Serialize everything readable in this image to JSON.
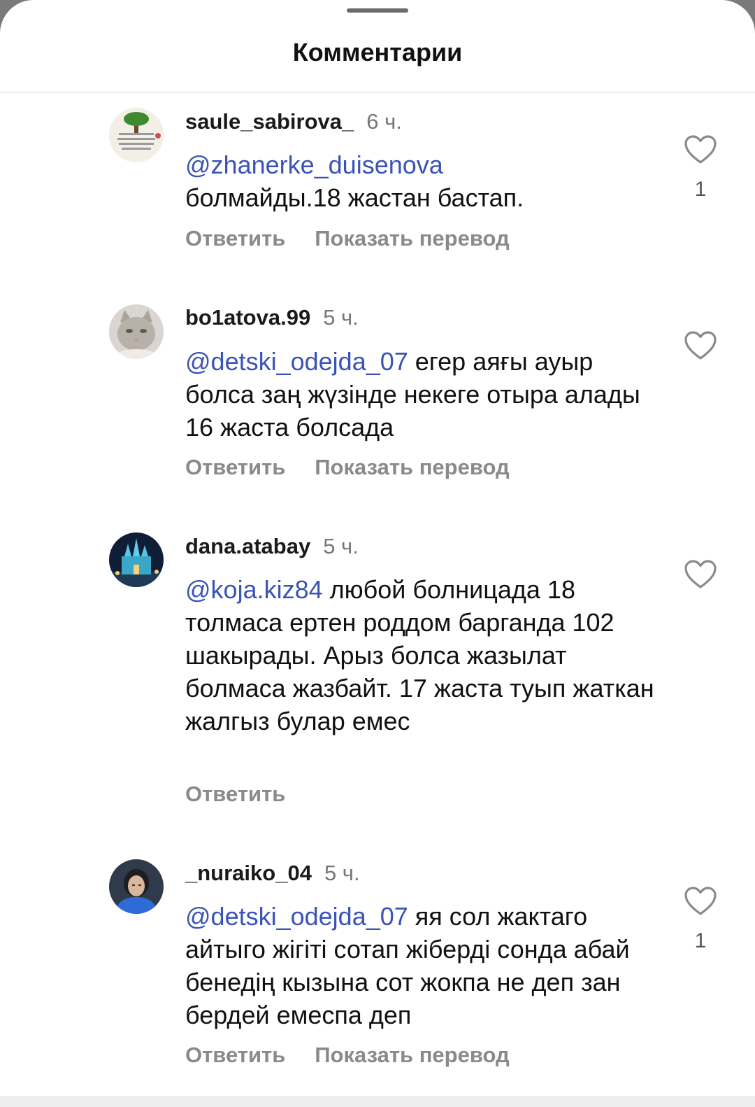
{
  "header": {
    "title": "Комментарии"
  },
  "comments": [
    {
      "username": "saule_sabirova_",
      "time": "6 ч.",
      "mention": "@zhanerke_duisenova",
      "text": "болмайды.18 жастан  бастап.",
      "reply": "Ответить",
      "translate": "Показать перевод",
      "likes": "1",
      "avatar": "tree-avatar"
    },
    {
      "username": "bo1atova.99",
      "time": "5 ч.",
      "mention": "@detski_odejda_07",
      "text": " егер аяғы ауыр болса заң жүзінде некеге отыра алады 16 жаста болсада",
      "reply": "Ответить",
      "translate": "Показать перевод",
      "likes": "",
      "avatar": "cat-avatar"
    },
    {
      "username": "dana.atabay",
      "time": "5 ч.",
      "mention": "@koja.kiz84",
      "text": " любой болницада 18 толмаса ертен роддом барганда 102 шакырады. Арыз болса жазылат болмаса жазбайт. 17 жаста туып жаткан жалгыз булар емес",
      "reply": "Ответить",
      "translate": "",
      "likes": "",
      "avatar": "castle-avatar"
    },
    {
      "username": "_nuraiko_04",
      "time": "5 ч.",
      "mention": "@detski_odejda_07",
      "text": " яя сол жактаго айтыго жігіті сотап жіберді сонда абай бенедің кызына сот жокпа не деп зан бердей емеспа деп",
      "reply": "Ответить",
      "translate": "Показать перевод",
      "likes": "1",
      "avatar": "person-avatar"
    }
  ],
  "colors": {
    "mention": "#3a53b6",
    "muted": "#8a8a8a"
  }
}
